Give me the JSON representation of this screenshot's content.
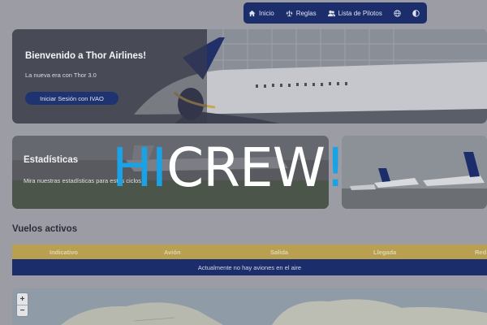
{
  "nav": {
    "items": [
      {
        "label": "Inicio",
        "icon": "home-icon"
      },
      {
        "label": "Reglas",
        "icon": "scale-icon"
      },
      {
        "label": "Lista de Pilotos",
        "icon": "users-icon"
      }
    ],
    "language_icon": "globe-icon",
    "theme_icon": "contrast-icon"
  },
  "hero": {
    "title": "Bienvenido a Thor Airlines!",
    "subtitle": "La nueva era con Thor 3.0",
    "login_button": "Iniciar Sesión con IVAO"
  },
  "stats_card": {
    "title": "Estadísticas",
    "subtitle": "Mira nuestras estadísticas para estos ciclos"
  },
  "flights": {
    "title": "Vuelos activos",
    "columns": [
      "Indicativo",
      "Avión",
      "Salida",
      "Llegada",
      "Red"
    ],
    "empty_message": "Actualmente no hay aviones en el aire"
  },
  "map": {
    "zoom_in": "+",
    "zoom_out": "−"
  },
  "watermark": {
    "part1": "HI",
    "part2": "CREW",
    "part3": "!"
  },
  "colors": {
    "nav_bg": "#1c2d6b",
    "table_header": "#b8a050",
    "table_body": "#1c2d6b",
    "watermark_blue": "#1aa2e6",
    "watermark_white": "#ffffff"
  }
}
